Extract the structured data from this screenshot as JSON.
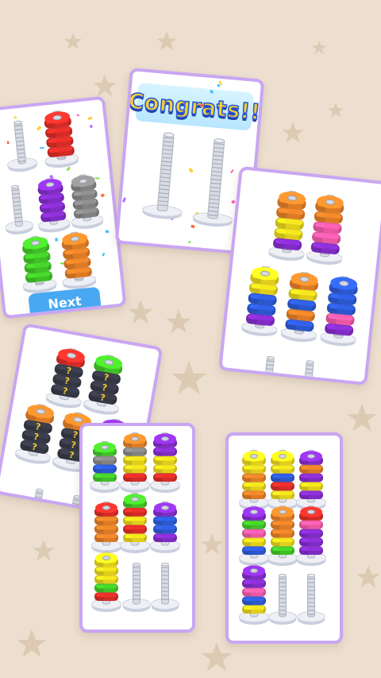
{
  "background_color": "#ecdfcf",
  "card_border_color": "#c9a6f2",
  "card_2": {
    "banner_text": "Congrats!!"
  },
  "card_1": {
    "next_label": "Next"
  },
  "nut_colors": {
    "red": "#e8302a",
    "purple": "#8b2fd6",
    "gray": "#8d8d8d",
    "green": "#46d12a",
    "orange": "#f0852a",
    "yellow": "#f4e01e",
    "pink": "#ff5fb0",
    "blue": "#2f5fe0",
    "dark": "#3b3d4a"
  },
  "unknown_marker": "?"
}
